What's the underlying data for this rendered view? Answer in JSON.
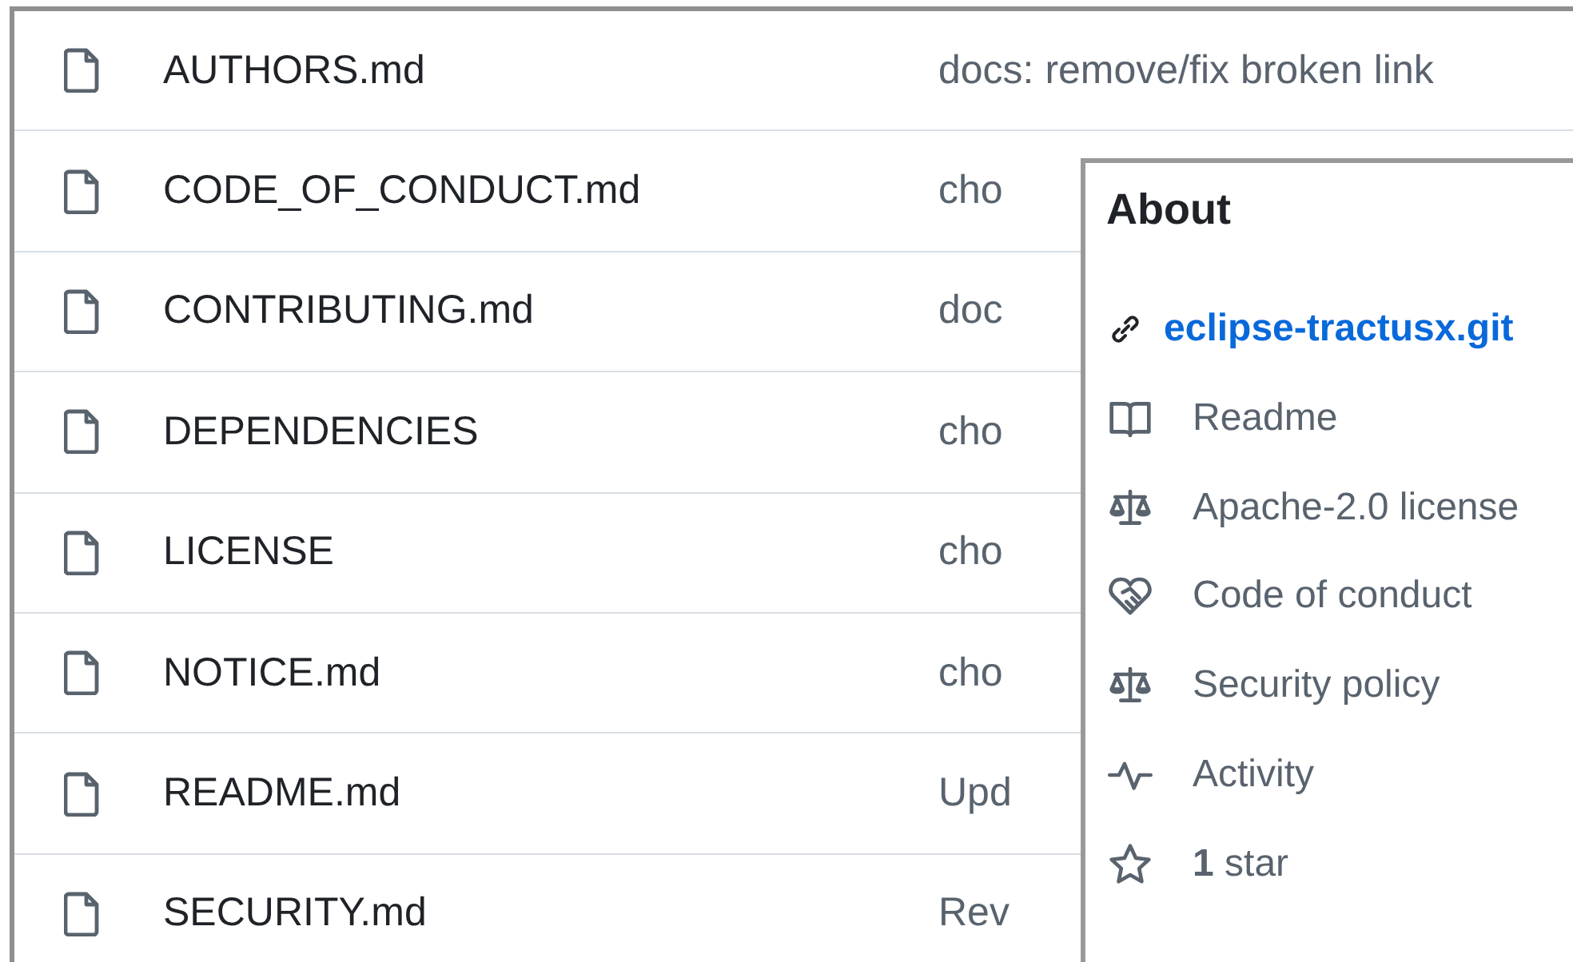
{
  "files": [
    {
      "name": "AUTHORS.md",
      "commit": "docs: remove/fix broken link"
    },
    {
      "name": "CODE_OF_CONDUCT.md",
      "commit": "cho"
    },
    {
      "name": "CONTRIBUTING.md",
      "commit": "doc"
    },
    {
      "name": "DEPENDENCIES",
      "commit": "cho"
    },
    {
      "name": "LICENSE",
      "commit": "cho"
    },
    {
      "name": "NOTICE.md",
      "commit": "cho"
    },
    {
      "name": "README.md",
      "commit": "Upd"
    },
    {
      "name": "SECURITY.md",
      "commit": "Rev"
    }
  ],
  "about": {
    "title": "About",
    "link": "eclipse-tractusx.git",
    "items": [
      {
        "kind": "readme",
        "label": "Readme"
      },
      {
        "kind": "license",
        "label": "Apache-2.0 license"
      },
      {
        "kind": "conduct",
        "label": "Code of conduct"
      },
      {
        "kind": "security",
        "label": "Security policy"
      },
      {
        "kind": "activity",
        "label": "Activity"
      },
      {
        "kind": "star",
        "label": "**1** star"
      }
    ]
  }
}
